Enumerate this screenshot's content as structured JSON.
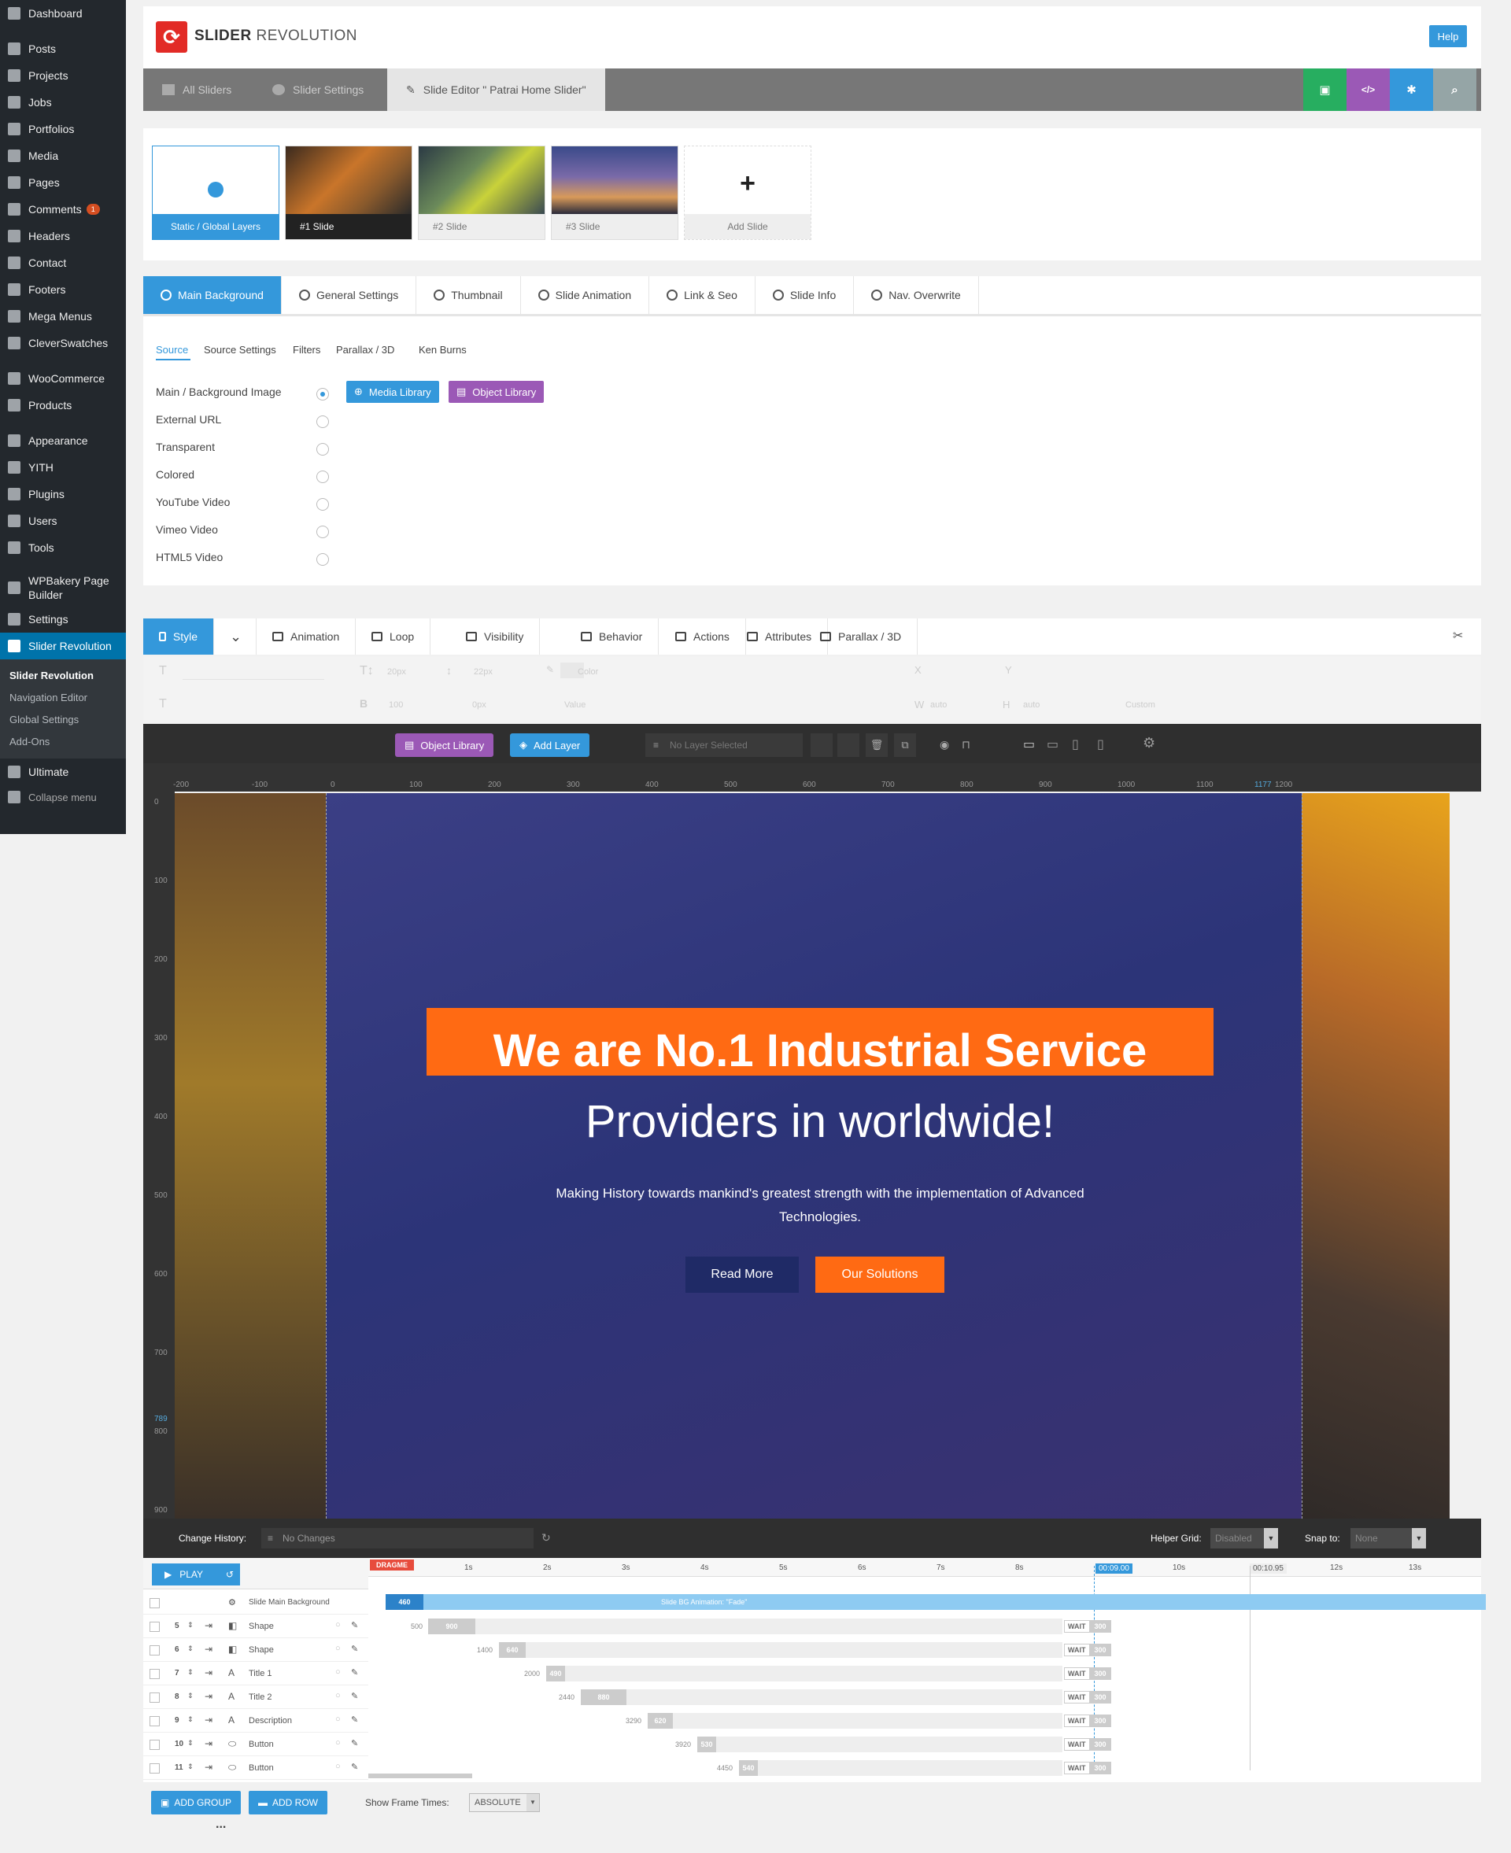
{
  "wp_menu": {
    "items": [
      {
        "label": "Dashboard",
        "icon": "dashboard-icon"
      },
      {
        "label": "Posts",
        "icon": "pin-icon"
      },
      {
        "label": "Projects",
        "icon": "list-icon"
      },
      {
        "label": "Jobs",
        "icon": "list-icon"
      },
      {
        "label": "Portfolios",
        "icon": "list-icon"
      },
      {
        "label": "Media",
        "icon": "media-icon"
      },
      {
        "label": "Pages",
        "icon": "page-icon"
      },
      {
        "label": "Comments",
        "icon": "comment-icon",
        "badge": "1"
      },
      {
        "label": "Headers",
        "icon": "grid-icon"
      },
      {
        "label": "Contact",
        "icon": "mail-icon"
      },
      {
        "label": "Footers",
        "icon": "grid-icon"
      },
      {
        "label": "Mega Menus",
        "icon": "grid-icon"
      },
      {
        "label": "CleverSwatches",
        "icon": "swatch-icon"
      },
      {
        "label": "WooCommerce",
        "icon": "woo-icon"
      },
      {
        "label": "Products",
        "icon": "box-icon"
      },
      {
        "label": "Appearance",
        "icon": "brush-icon"
      },
      {
        "label": "YITH",
        "icon": "wrench-icon"
      },
      {
        "label": "Plugins",
        "icon": "plug-icon"
      },
      {
        "label": "Users",
        "icon": "user-icon"
      },
      {
        "label": "Tools",
        "icon": "tool-icon"
      },
      {
        "label": "WPBakery Page Builder",
        "icon": "wpb-icon"
      },
      {
        "label": "Settings",
        "icon": "settings-icon"
      },
      {
        "label": "Slider Revolution",
        "icon": "refresh-icon"
      }
    ],
    "submenu": [
      "Slider Revolution",
      "Navigation Editor",
      "Global Settings",
      "Add-Ons"
    ],
    "after": [
      {
        "label": "Ultimate",
        "icon": "shield-icon"
      },
      {
        "label": "Collapse menu",
        "icon": "collapse-icon"
      }
    ]
  },
  "header": {
    "brand_bold": "SLIDER",
    "brand_light": " REVOLUTION",
    "help": "Help"
  },
  "topbar": {
    "all_sliders": "All Sliders",
    "slider_settings": "Slider Settings",
    "slide_editor": "Slide Editor \" Patrai Home Slider\"",
    "actions": [
      {
        "icon": "save-icon",
        "color": "#27ae60"
      },
      {
        "icon": "code-icon",
        "color": "#9b59b6"
      },
      {
        "icon": "gear-icon",
        "color": "#3498db"
      },
      {
        "icon": "search-icon",
        "color": "#95a5a6"
      }
    ]
  },
  "slides": [
    {
      "label": "Static / Global Layers"
    },
    {
      "label": "#1 Slide"
    },
    {
      "label": "#2 Slide"
    },
    {
      "label": "#3 Slide"
    },
    {
      "label": "Add Slide"
    }
  ],
  "settings_tabs": [
    "Main Background",
    "General Settings",
    "Thumbnail",
    "Slide Animation",
    "Link & Seo",
    "Slide Info",
    "Nav. Overwrite"
  ],
  "source_tabs": [
    "Source",
    "Source Settings",
    "Filters",
    "Parallax / 3D",
    "Ken Burns"
  ],
  "bg_options": [
    "Main / Background Image",
    "External URL",
    "Transparent",
    "Colored",
    "YouTube Video",
    "Vimeo Video",
    "HTML5 Video"
  ],
  "bg_buttons": [
    "Media Library",
    "Object Library"
  ],
  "layer_tabs": [
    "Style",
    "Animation",
    "Loop",
    "Visibility",
    "Behavior",
    "Actions",
    "Attributes",
    "Parallax / 3D"
  ],
  "toolbar_fields": {
    "font_size": "20px",
    "line_height": "22px",
    "color": "Color",
    "weight": "100",
    "spacing": "0px",
    "value": "Value",
    "x": "X",
    "y": "Y",
    "w": "W",
    "w_val": "auto",
    "h": "H",
    "h_val": "auto",
    "custom": "Custom"
  },
  "canvas_bar": {
    "object_library": "Object Library",
    "add_layer": "Add Layer",
    "no_layer": "No Layer Selected"
  },
  "ruler": {
    "top": [
      "-200",
      "-100",
      "0",
      "100",
      "200",
      "300",
      "400",
      "500",
      "600",
      "700",
      "800",
      "900",
      "1000",
      "1100",
      "1177",
      "1200"
    ],
    "left": [
      "0",
      "100",
      "200",
      "300",
      "400",
      "500",
      "600",
      "700",
      "789",
      "800",
      "900"
    ]
  },
  "slide_content": {
    "title1": "We are No.1 Industrial Service",
    "title2": "Providers in worldwide!",
    "description": "Making History towards mankind's greatest strength with the implementation of Advanced Technologies.",
    "button1": "Read More",
    "button2": "Our Solutions",
    "orange": "#ff6a13",
    "navy": "#1f2a66"
  },
  "history": {
    "label": "Change History:",
    "value": "No Changes",
    "helper_grid": "Helper Grid:",
    "helper_value": "Disabled",
    "snap_to": "Snap to:",
    "snap_value": "None"
  },
  "timeline": {
    "play": "PLAY",
    "dragme": "DRAGME",
    "seconds": [
      "1s",
      "2s",
      "3s",
      "4s",
      "5s",
      "6s",
      "7s",
      "8s",
      "00:09.00",
      "10s",
      "00:10.95",
      "12s",
      "13s"
    ],
    "bg_row": {
      "label": "Slide Main Background",
      "start": "460",
      "anim": "Slide BG Animation: \"Fade\""
    },
    "layers": [
      {
        "num": "5",
        "type": "Shape",
        "start": "500",
        "dur": "900"
      },
      {
        "num": "6",
        "type": "Shape",
        "start": "1400",
        "dur": "640"
      },
      {
        "num": "7",
        "type": "Title 1",
        "start": "2000",
        "dur": "490"
      },
      {
        "num": "8",
        "type": "Title 2",
        "start": "2440",
        "dur": "880"
      },
      {
        "num": "9",
        "type": "Description",
        "start": "3290",
        "dur": "620"
      },
      {
        "num": "10",
        "type": "Button",
        "start": "3920",
        "dur": "530"
      },
      {
        "num": "11",
        "type": "Button",
        "start": "4450",
        "dur": "540"
      }
    ],
    "wait": "WAIT",
    "wait_val": "300"
  },
  "footer": {
    "add_group": "ADD GROUP",
    "add_row": "ADD ROW",
    "frame_times": "Show Frame Times:",
    "frame_value": "ABSOLUTE",
    "more": "..."
  }
}
